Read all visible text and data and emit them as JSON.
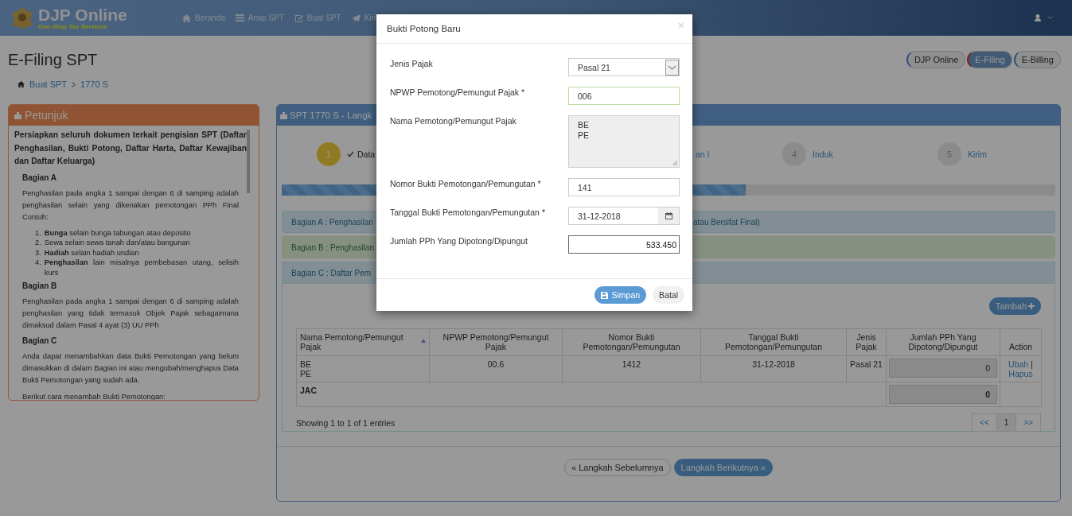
{
  "header": {
    "logo_title": "DJP Online",
    "logo_subtitle": "One-Stop Tax Services",
    "nav": [
      {
        "label": "Beranda"
      },
      {
        "label": "Arsip SPT"
      },
      {
        "label": "Buat SPT"
      },
      {
        "label": "Kiri"
      }
    ]
  },
  "page_title": "E-Filing SPT",
  "breadcrumb": [
    "Buat SPT",
    "1770 S"
  ],
  "app_tabs": [
    {
      "label": "DJP Online",
      "selected": false
    },
    {
      "label": "E-Filing",
      "selected": true
    },
    {
      "label": "E-Billing",
      "selected": false
    }
  ],
  "hint_panel": {
    "title": "Petunjuk",
    "content": [
      {
        "kind": "intro",
        "text": "Persiapkan seluruh dokumen terkait pengisian SPT (Daftar Penghasilan, Bukti Potong, Daftar Harta, Daftar Kewajiban dan Daftar Keluarga)"
      },
      {
        "kind": "heading",
        "text": "Bagian A"
      },
      {
        "kind": "paragraph",
        "text": "Penghasilan pada angka 1 sampai dengan 6 di samping adalah penghasilan selain yang dikenakan pemotongan PPh Final Contoh:"
      },
      {
        "kind": "list",
        "items": [
          {
            "number": "1.",
            "text": "**Bunga** selain bunga tabungan atau deposito"
          },
          {
            "number": "2.",
            "text": "Sewa selain sewa tanah dan/atau bangunan"
          },
          {
            "number": "3.",
            "text": "**Hadiah** selain hadiah undian"
          },
          {
            "number": "4.",
            "text": "**Penghasilan** lain misalnya pembebasan utang, selisih kurs"
          }
        ]
      },
      {
        "kind": "heading",
        "text": "Bagian B"
      },
      {
        "kind": "paragraph",
        "text": "Penghasilan pada angka 1 sampai dengan 6 di samping adalah penghasilan yang tidak termasuk Objek Pajak sebagaimana dimaksud dalam Pasal 4 ayat (3) UU PPh"
      },
      {
        "kind": "heading",
        "text": "Bagian C"
      },
      {
        "kind": "paragraph",
        "text": "Anda dapat menambahkan data Bukti Pemotongan yang belum dimasukkan di dalam Bagian ini atau mengubah/menghapus Data Bukti Pemotongan yang sudah ada."
      },
      {
        "kind": "paragraph",
        "text": "Berikut cara menambah Bukti Pemotongan:"
      }
    ]
  },
  "spt_panel": {
    "title": "SPT 1770 S - Langk",
    "steps": [
      {
        "number": "1",
        "label": "Data",
        "done": true,
        "selected": true
      },
      {
        "label": "an I",
        "done": false,
        "selected": false
      },
      {
        "number": "4",
        "label": "Induk",
        "done": false,
        "selected": false
      },
      {
        "number": "5",
        "label": "Kirim",
        "done": false,
        "selected": false
      }
    ],
    "progress": {
      "level": 0.6
    },
    "sections": [
      {
        "kind": "info",
        "title": "Bagian A : Penghasilan",
        "title_end": "atau Bersifat Final)",
        "expanded": false
      },
      {
        "kind": "success",
        "title": "Bagian B : Penghasilan",
        "expanded": false
      },
      {
        "kind": "info",
        "title": "Bagian C : Daftar Pem",
        "expanded": true
      }
    ],
    "add_button": "Tambah",
    "table": {
      "columns": [
        {
          "label": "Nama Pemotong/Pemungut Pajak",
          "sorted": true
        },
        {
          "label": "NPWP Pemotong/Pemungut Pajak",
          "sorted": false
        },
        {
          "label": "Nomor Bukti Pemotongan/Pemungutan",
          "sorted": false
        },
        {
          "label": "Tanggal Bukti Pemotongan/Pemungutan",
          "sorted": false
        },
        {
          "label": "Jenis Pajak",
          "sorted": false
        },
        {
          "label": "Jumlah PPh Yang Dipotong/Dipungut",
          "sorted": false
        },
        {
          "label": "Action",
          "sorted": false
        }
      ],
      "rows": [
        {
          "kind": "entry",
          "cells": [
            "BE\nPE",
            "00.6",
            "1412",
            "31-12-2018",
            "Pasal 21"
          ],
          "amount": "0",
          "actions": [
            "Ubah",
            "Hapus"
          ]
        },
        {
          "kind": "total",
          "label": "JAC",
          "amount": "0"
        }
      ],
      "action_separator": "|"
    },
    "entries_info": "Showing 1 to 1 of 1 entries",
    "pagination": [
      {
        "label": "<<",
        "selected": false
      },
      {
        "label": "1",
        "selected": true
      },
      {
        "label": ">>",
        "selected": false
      }
    ],
    "prev_button": "« Langkah Sebelumnya",
    "next_button": "Langkah Berikutnya »"
  },
  "modal": {
    "title": "Bukti Potong Baru",
    "close": "×",
    "fields": [
      {
        "kind": "select",
        "label": "Jenis Pajak",
        "value": "Pasal 21",
        "disabled": false,
        "focused": false,
        "valid": false
      },
      {
        "kind": "text",
        "label": "NPWP Pemotong/Pemungut Pajak *",
        "value": "006",
        "disabled": false,
        "focused": false,
        "valid": true
      },
      {
        "kind": "textarea",
        "label": "Nama Pemotong/Pemungut Pajak",
        "value": "BE\nPE",
        "disabled": true,
        "focused": false,
        "valid": false
      },
      {
        "kind": "text",
        "label": "Nomor Bukti Pemotongan/Pemungutan *",
        "value": "141",
        "disabled": false,
        "focused": false,
        "valid": false
      },
      {
        "kind": "date",
        "label": "Tanggal Bukti Pemotongan/Pemungutan *",
        "value": "31-12-2018",
        "disabled": false,
        "focused": false,
        "valid": false
      },
      {
        "kind": "amount",
        "label": "Jumlah PPh Yang Dipotong/Dipungut",
        "value": "533.450",
        "disabled": false,
        "focused": true,
        "valid": false
      }
    ],
    "buttons": [
      {
        "kind": "primary",
        "label": "Simpan"
      },
      {
        "kind": "default",
        "label": "Batal"
      }
    ]
  }
}
